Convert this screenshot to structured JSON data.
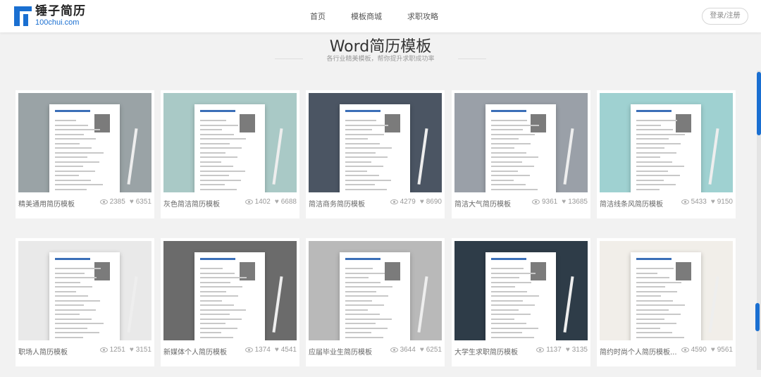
{
  "header": {
    "logo_cn": "锤子简历",
    "logo_en": "100chui.com",
    "nav": [
      "首页",
      "模板商城",
      "求职攻略"
    ],
    "login": "登录/注册"
  },
  "section": {
    "title": "Word简历模板",
    "subtitle": "各行业精美模板，帮你提升求职成功率"
  },
  "templates": [
    {
      "name": "精美通用简历模板",
      "views": "2385",
      "likes": "6351",
      "bg": "#9aa3a6"
    },
    {
      "name": "灰色简洁简历模板",
      "views": "1402",
      "likes": "6688",
      "bg": "#a9c9c6"
    },
    {
      "name": "简洁商务简历模板",
      "views": "4279",
      "likes": "8690",
      "bg": "#4b5563"
    },
    {
      "name": "简洁大气简历模板",
      "views": "9361",
      "likes": "13685",
      "bg": "#9aa0a8"
    },
    {
      "name": "简洁线条风简历模板",
      "views": "5433",
      "likes": "9150",
      "bg": "#9fd1d1"
    },
    {
      "name": "职场人简历模板",
      "views": "1251",
      "likes": "3151",
      "bg": "#e9e9e9"
    },
    {
      "name": "新媒体个人简历模板",
      "views": "1374",
      "likes": "4541",
      "bg": "#6b6b6b"
    },
    {
      "name": "应届毕业生简历模板",
      "views": "3644",
      "likes": "6251",
      "bg": "#b9b9b9"
    },
    {
      "name": "大学生求职简历模板",
      "views": "1137",
      "likes": "3135",
      "bg": "#2e3c48"
    },
    {
      "name": "简约时尚个人简历模板...",
      "views": "4590",
      "likes": "9561",
      "bg": "#f1eee9"
    }
  ]
}
